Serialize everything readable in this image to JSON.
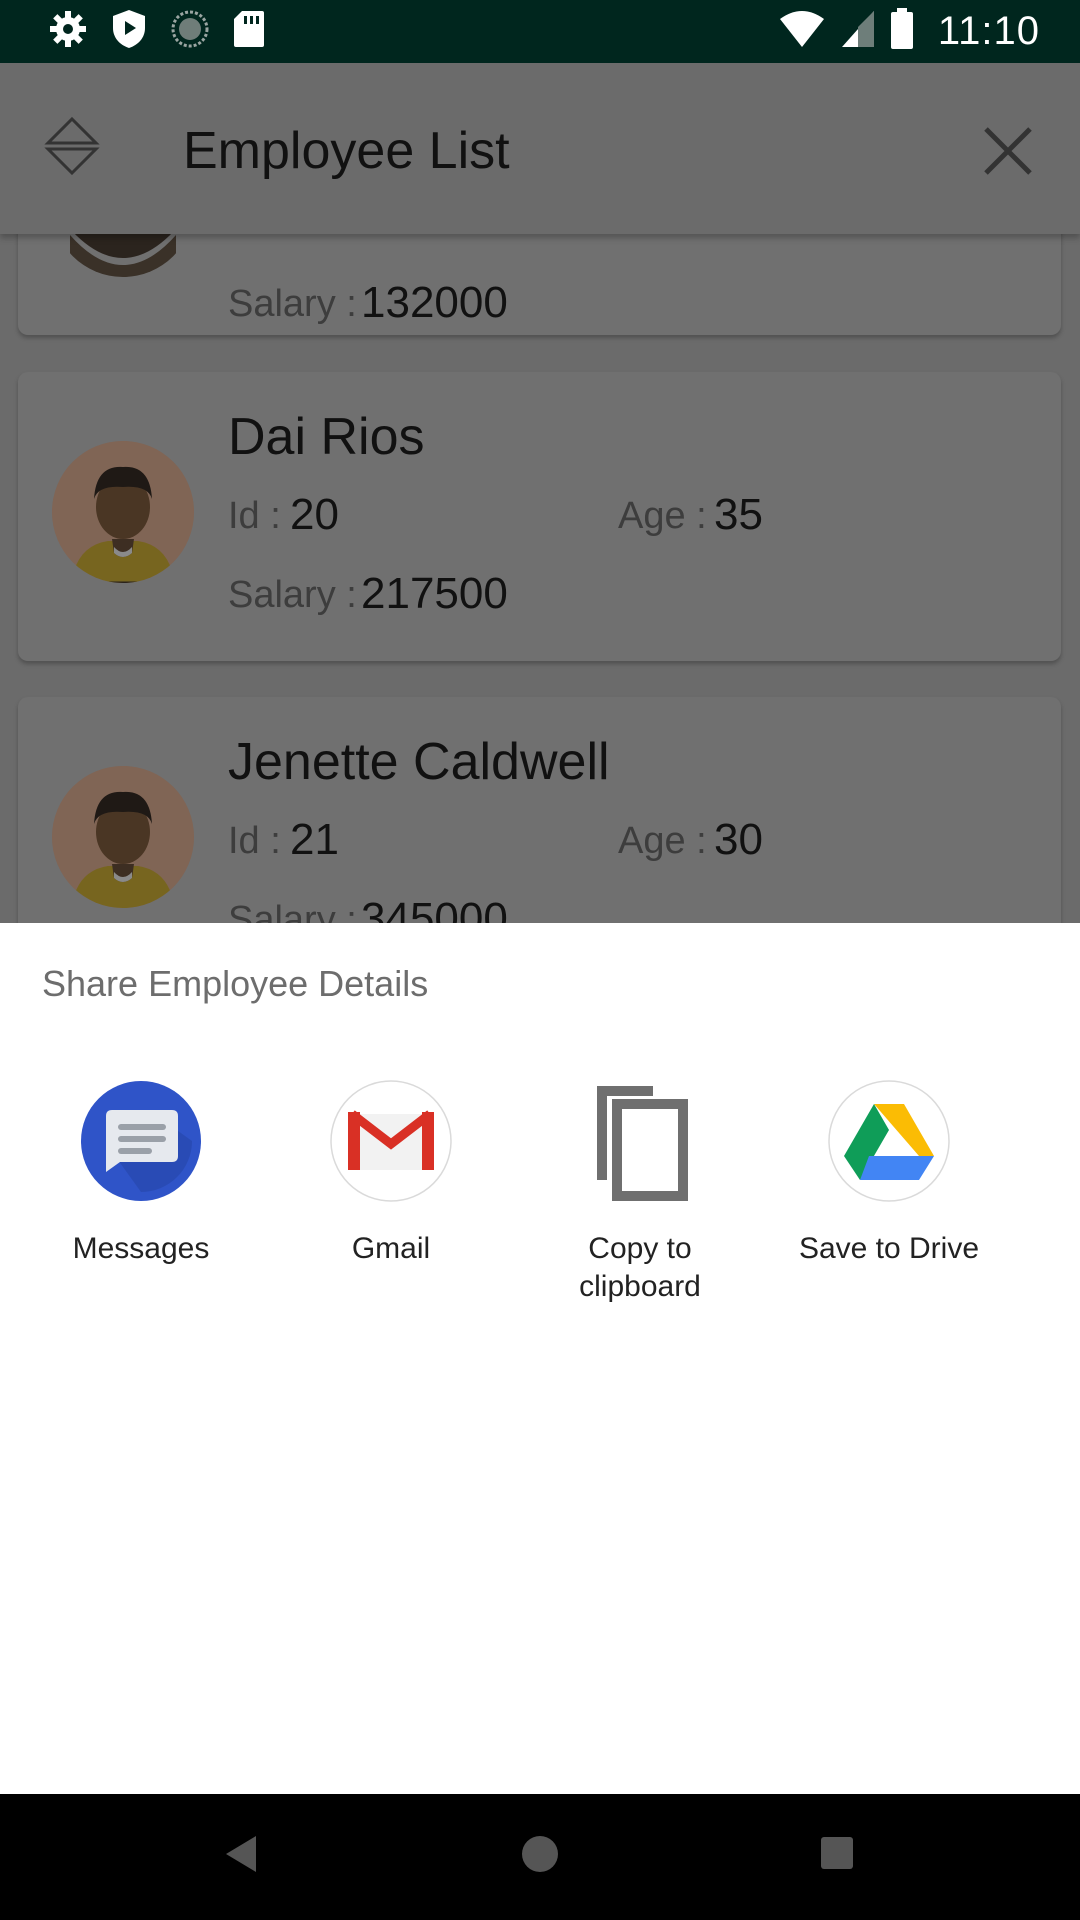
{
  "status_bar": {
    "time": "11:10",
    "left_icons": [
      "settings-icon",
      "shield-icon",
      "sync-icon",
      "sd-card-icon"
    ],
    "right_icons": [
      "wifi-icon",
      "signal-icon",
      "battery-icon"
    ]
  },
  "app_bar": {
    "title": "Employee List",
    "sort_icon": "sort-icon",
    "close_icon": "close-icon"
  },
  "employees": [
    {
      "name": "",
      "id_label": "Id :",
      "id": "",
      "age_label": "Age :",
      "age": "",
      "salary_label": "Salary :",
      "salary": "132000"
    },
    {
      "name": "Dai Rios",
      "id_label": "Id :",
      "id": "20",
      "age_label": "Age :",
      "age": "35",
      "salary_label": "Salary :",
      "salary": "217500"
    },
    {
      "name": "Jenette Caldwell",
      "id_label": "Id :",
      "id": "21",
      "age_label": "Age :",
      "age": "30",
      "salary_label": "Salary :",
      "salary": "345000"
    }
  ],
  "share_sheet": {
    "title": "Share Employee Details",
    "targets": [
      {
        "label": "Messages",
        "icon": "messages-icon"
      },
      {
        "label": "Gmail",
        "icon": "gmail-icon"
      },
      {
        "label": "Copy to clipboard",
        "icon": "copy-icon"
      },
      {
        "label": "Save to Drive",
        "icon": "drive-icon"
      }
    ]
  },
  "nav_bar": {
    "icons": [
      "back-icon",
      "home-icon",
      "recents-icon"
    ]
  },
  "colors": {
    "status_bar": "#00261e",
    "scrim_background": "#6b6b6b",
    "card": "#707070",
    "sheet": "#ffffff",
    "nav_bar": "#000000"
  }
}
